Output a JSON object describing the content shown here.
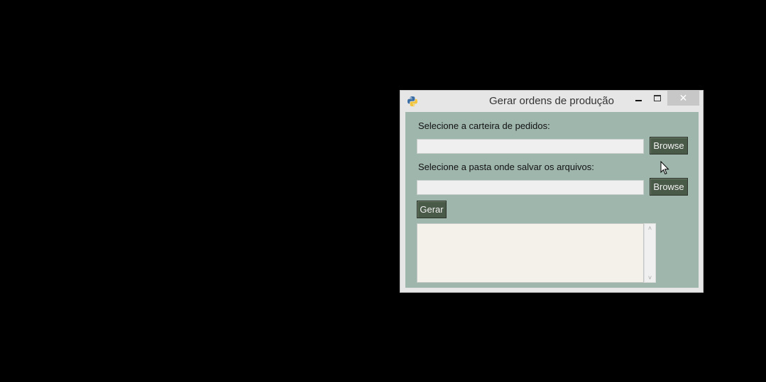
{
  "window": {
    "title": "Gerar ordens de produção",
    "close_symbol": "✕"
  },
  "form": {
    "label_orders": "Selecione a carteira de pedidos:",
    "orders_value": "",
    "label_folder": "Selecione a pasta onde salvar os arquivos:",
    "folder_value": "",
    "browse_label_1": "Browse",
    "browse_label_2": "Browse",
    "generate_label": "Gerar"
  },
  "output": {
    "text": "",
    "scroll_up": "˄",
    "scroll_down": "˅"
  },
  "icons": {
    "app": "python-icon",
    "minimize": "minimize-icon",
    "maximize": "maximize-icon",
    "close": "close-icon",
    "cursor": "mouse-cursor-icon"
  },
  "colors": {
    "background": "#000000",
    "window_frame": "#e6e6e6",
    "client_area": "#9fb6ad",
    "button": "#4a5a48",
    "close_button": "#c7c7c7",
    "output_area": "#f4f1ea"
  }
}
